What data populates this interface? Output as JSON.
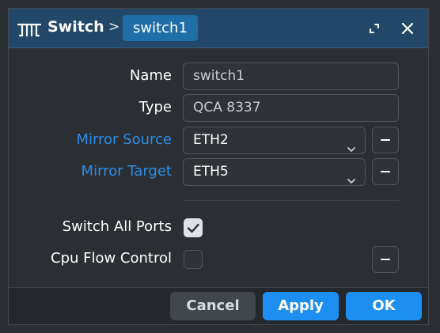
{
  "titlebar": {
    "app_icon": "switch-icon",
    "title": "Switch",
    "separator": ">",
    "item_chip": "switch1",
    "maximize_icon": "maximize-icon",
    "close_icon": "close-icon"
  },
  "form": {
    "name": {
      "label": "Name",
      "value": "switch1"
    },
    "type": {
      "label": "Type",
      "value": "QCA 8337"
    },
    "mirror_source": {
      "label": "Mirror Source",
      "value": "ETH2"
    },
    "mirror_target": {
      "label": "Mirror Target",
      "value": "ETH5"
    },
    "switch_all_ports": {
      "label": "Switch All Ports",
      "checked": true
    },
    "cpu_flow_control": {
      "label": "Cpu Flow Control",
      "checked": false
    }
  },
  "footer": {
    "cancel": "Cancel",
    "apply": "Apply",
    "ok": "OK"
  },
  "colors": {
    "titlebar": "#224768",
    "accent": "#1e8ff2",
    "link_label": "#2d8ee6"
  }
}
